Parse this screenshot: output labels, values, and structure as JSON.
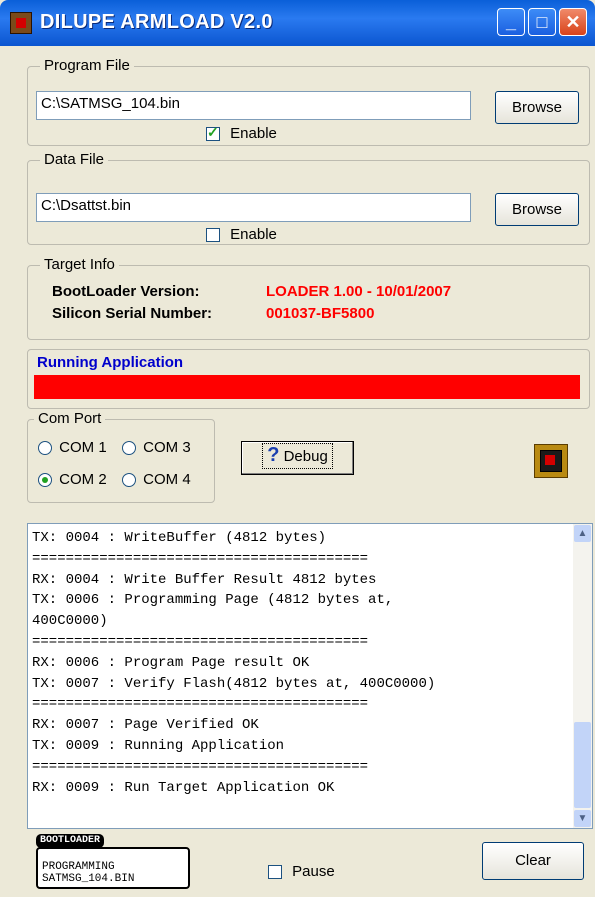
{
  "window": {
    "title": "DILUPE ARMLOAD V2.0",
    "minimize": "_",
    "maximize": "□",
    "close": "✕"
  },
  "program_file": {
    "legend": "Program File",
    "path": "C:\\SATMSG_104.bin",
    "browse_label": "Browse",
    "enable_label": "Enable",
    "enabled": true
  },
  "data_file": {
    "legend": "Data File",
    "path": "C:\\Dsattst.bin",
    "browse_label": "Browse",
    "enable_label": "Enable",
    "enabled": false
  },
  "target_info": {
    "legend": "Target Info",
    "bootloader_label": "BootLoader Version:",
    "bootloader_value": "LOADER 1.00 - 10/01/2007",
    "serial_label": "Silicon Serial Number:",
    "serial_value": "001037-BF5800",
    "value_color": "#ff0000"
  },
  "status": {
    "text": "Running Application",
    "progress": 1.0,
    "bar_color": "#ff0000",
    "text_color": "#0000cc"
  },
  "com_port": {
    "legend": "Com Port",
    "com1": "COM 1",
    "com2": "COM 2",
    "com3": "COM 3",
    "com4": "COM 4",
    "selected": "COM 2"
  },
  "debug_button": {
    "label": "Debug",
    "icon": "question-icon"
  },
  "chip_icon": "chip-icon",
  "log": {
    "lines": [
      "TX: 0004 : WriteBuffer (4812 bytes)",
      "========================================",
      "RX: 0004 : Write Buffer Result 4812 bytes",
      "TX: 0006 : Programming Page (4812 bytes at,",
      "400C0000)",
      "========================================",
      "RX: 0006 : Program Page result OK",
      "TX: 0007 : Verify Flash(4812 bytes at, 400C0000)",
      "========================================",
      "RX: 0007 : Page Verified OK",
      "TX: 0009 : Running Application",
      "========================================",
      "RX: 0009 : Run Target Application OK"
    ]
  },
  "bootloader_panel": {
    "tag": "BOOTLOADER",
    "line1": "PROGRAMMING",
    "line2": "SATMSG_104.BIN"
  },
  "pause": {
    "label": "Pause",
    "checked": false
  },
  "clear_button": {
    "label": "Clear"
  }
}
